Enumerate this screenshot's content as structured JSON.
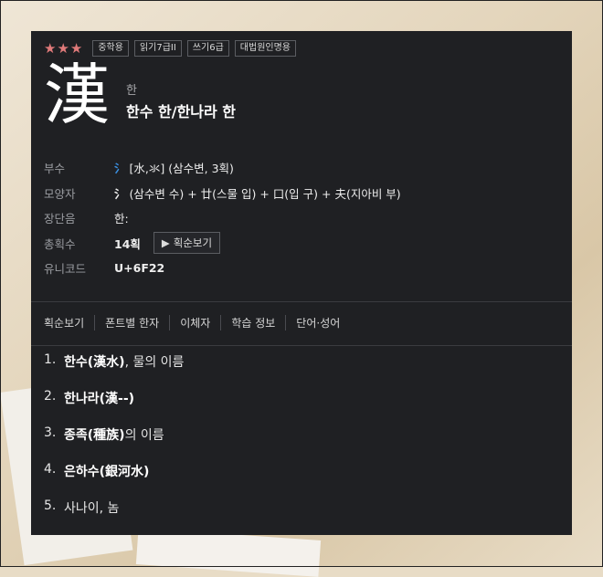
{
  "rating_stars": "★★★",
  "tags": [
    "중학용",
    "읽기7급II",
    "쓰기6급",
    "대법원인명용"
  ],
  "character": {
    "hanja": "漢",
    "reading": "한",
    "meaning": "한수 한/한나라 한"
  },
  "info": {
    "radical": {
      "label": "부수",
      "glyph": "氵",
      "detail": "[水,氺]",
      "desc": "(삼수변, 3획)"
    },
    "shape": {
      "label": "모양자",
      "glyph": "氵",
      "parts": "(삼수변 수) + 廿(스물 입) + 口(입 구) + 夫(지아비 부)"
    },
    "length": {
      "label": "장단음",
      "value": "한:"
    },
    "strokes": {
      "label": "총획수",
      "value": "14획",
      "button": "획순보기"
    },
    "unicode": {
      "label": "유니코드",
      "value": "U+6F22"
    }
  },
  "tabs": [
    "획순보기",
    "폰트별 한자",
    "이체자",
    "학습 정보",
    "단어·성어"
  ],
  "meanings": [
    {
      "num": "1.",
      "word": "한수(漢水)",
      "rest": ", 물의 이름"
    },
    {
      "num": "2.",
      "word": "한나라(漢--)",
      "rest": ""
    },
    {
      "num": "3.",
      "word": "종족(種族)",
      "rest": "의 이름"
    },
    {
      "num": "4.",
      "word": "은하수(銀河水)",
      "rest": ""
    },
    {
      "num": "5.",
      "word": "사나이, 놈",
      "rest": ""
    }
  ],
  "colors": {
    "panel": "#1f2023",
    "stars": "#e07a7a",
    "radical": "#3a8fe0"
  }
}
